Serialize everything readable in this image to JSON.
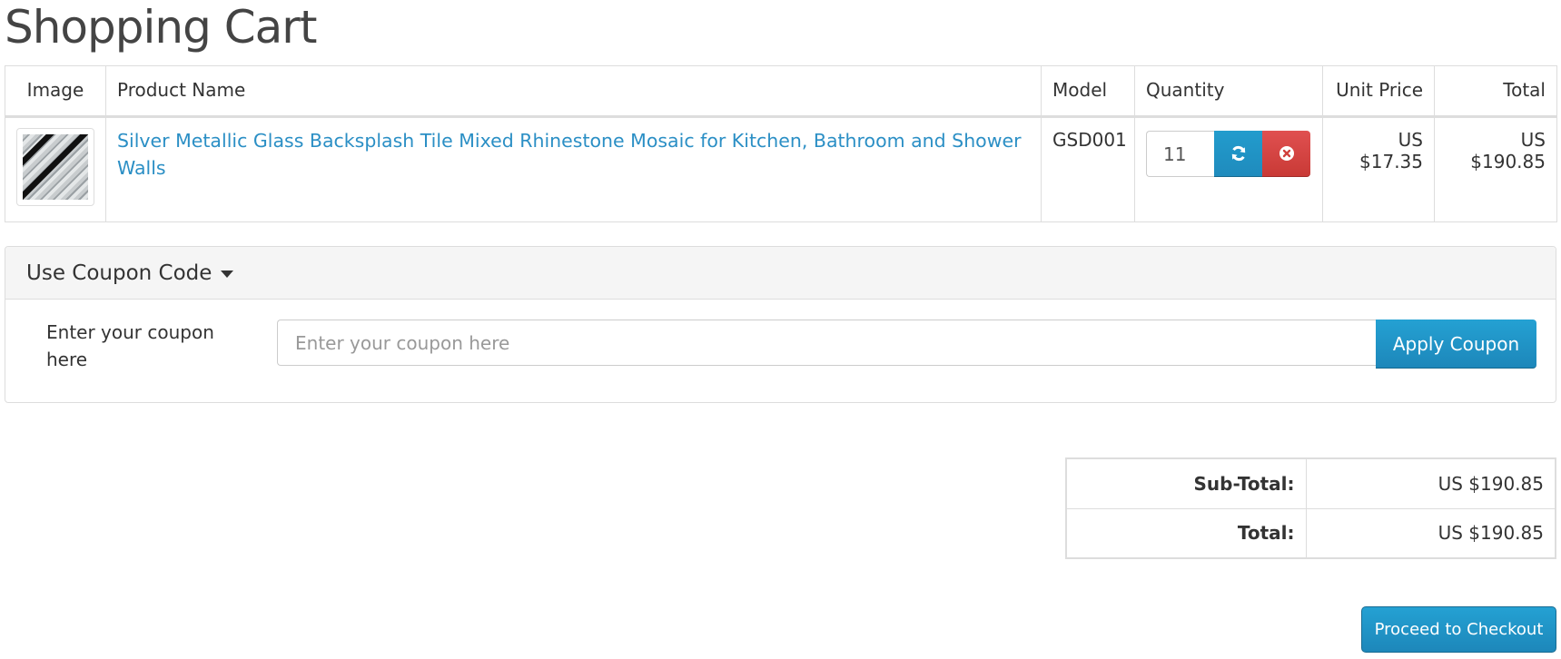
{
  "page": {
    "title": "Shopping Cart"
  },
  "cart": {
    "headers": {
      "image": "Image",
      "product_name": "Product Name",
      "model": "Model",
      "quantity": "Quantity",
      "unit_price": "Unit Price",
      "total": "Total"
    },
    "items": [
      {
        "image_icon": "product-thumbnail",
        "product_name": "Silver Metallic Glass Backsplash Tile Mixed Rhinestone Mosaic for Kitchen, Bathroom and Shower Walls",
        "model": "GSD001",
        "quantity": "11",
        "unit_price": "US $17.35",
        "total": "US $190.85",
        "update_icon": "refresh-icon",
        "remove_icon": "times-circle-icon"
      }
    ]
  },
  "coupon": {
    "heading": "Use Coupon Code",
    "heading_icon": "caret-down-icon",
    "label": "Enter your coupon here",
    "input_value": "",
    "input_placeholder": "Enter your coupon here",
    "apply_label": "Apply Coupon"
  },
  "totals": [
    {
      "label": "Sub-Total:",
      "value": "US $190.85"
    },
    {
      "label": "Total:",
      "value": "US $190.85"
    }
  ],
  "actions": {
    "checkout_label": "Proceed to Checkout"
  },
  "colors": {
    "primary": "#229ac8",
    "danger": "#da4f49",
    "link": "#2b8fc5",
    "text": "#333333"
  }
}
